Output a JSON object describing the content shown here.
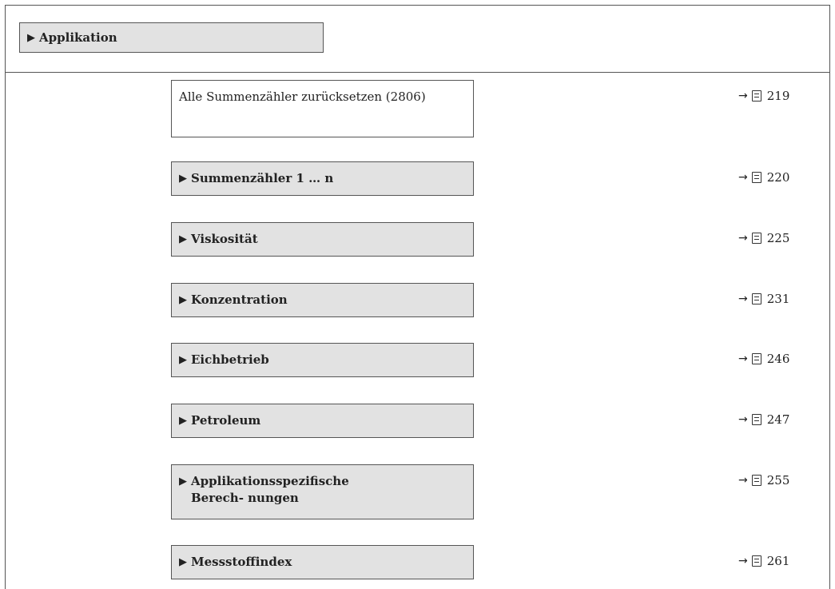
{
  "header": {
    "label": "Applikation",
    "arrow": "▶"
  },
  "items": [
    {
      "label": "Alle Summenzähler zurücksetzen (2806)",
      "kind": "parameter",
      "ref_arrow": "→",
      "ref_page": "219"
    },
    {
      "label": "Summenzähler 1 … n",
      "kind": "group",
      "ref_arrow": "→",
      "ref_page": "220"
    },
    {
      "label": "Viskosität",
      "kind": "group",
      "ref_arrow": "→",
      "ref_page": "225"
    },
    {
      "label": "Konzentration",
      "kind": "group",
      "ref_arrow": "→",
      "ref_page": "231"
    },
    {
      "label": "Eichbetrieb",
      "kind": "group",
      "ref_arrow": "→",
      "ref_page": "246"
    },
    {
      "label": "Petroleum",
      "kind": "group",
      "ref_arrow": "→",
      "ref_page": "247"
    },
    {
      "label": "Applikationsspezifische Berech- nungen",
      "kind": "group",
      "ref_arrow": "→",
      "ref_page": "255"
    },
    {
      "label": "Messstoffindex",
      "kind": "group",
      "ref_arrow": "→",
      "ref_page": "261"
    }
  ],
  "icons": {
    "group_arrow": "triangle-right-icon",
    "ref_icon": "book-icon"
  }
}
